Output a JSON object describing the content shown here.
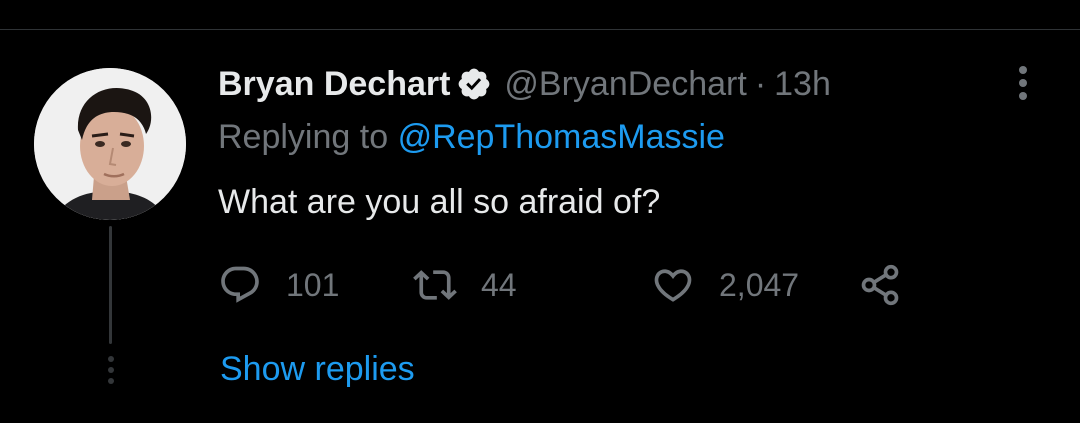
{
  "tweet": {
    "author": {
      "display_name": "Bryan Dechart",
      "handle": "@BryanDechart",
      "verified": true,
      "avatar_icon": "profile-photo"
    },
    "separator": "·",
    "timestamp": "13h",
    "replying_prefix": "Replying to",
    "replying_to": "@RepThomasMassie",
    "text": "What are you all so afraid of?",
    "actions": {
      "reply_count": "101",
      "retweet_count": "44",
      "like_count": "2,047"
    }
  },
  "thread": {
    "show_replies_label": "Show replies"
  },
  "colors": {
    "background": "#000000",
    "text_primary": "#e7e9ea",
    "text_secondary": "#71767b",
    "accent": "#1d9bf0",
    "divider": "#2f3336"
  }
}
